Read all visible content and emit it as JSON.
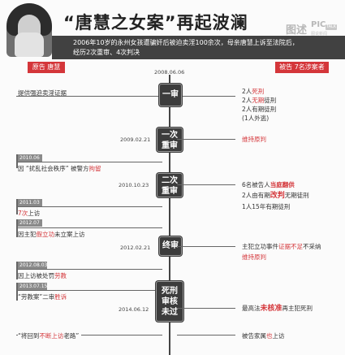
{
  "header": {
    "title": "“唐慧之女案”再起波澜",
    "logo_cn": "图述",
    "logo_pic": "PIC",
    "logo_tag": "TALK",
    "logo_sub": "图说新闻",
    "summary_line1": "2006年10岁的永州女孩遭骗奸后被迫卖淫100余次，母亲唐慧上诉至法院后，",
    "summary_line2": "经历2次重审、4次判决"
  },
  "badges": {
    "left": "原告 唐慧",
    "right": "被告 7名涉案者"
  },
  "top_date": "2008.06.06",
  "stages": [
    {
      "label": "一审",
      "date": ""
    },
    {
      "label_l1": "一次",
      "label_l2": "重审",
      "date": "2009.02.21"
    },
    {
      "label_l1": "二次",
      "label_l2": "重审",
      "date": "2010.10.23"
    },
    {
      "label": "终审",
      "date": "2012.02.21"
    },
    {
      "label_l1": "死刑",
      "label_l2": "审核",
      "label_l3": "未过",
      "date": "2014.06.12"
    }
  ],
  "left_events": [
    {
      "text": "提供强迫卖淫证据"
    },
    {
      "tag": "2010.06",
      "pre": "因 “扰乱社会秩序” 被警方",
      "hl": "拘留"
    },
    {
      "tag": "2011.03",
      "hl": "7次",
      "post": "上访"
    },
    {
      "tag": "2012.07",
      "pre": "因主犯",
      "hl": "假立功",
      "post": "未立案上访"
    },
    {
      "tag": "2012.08.03",
      "pre": "因上访被处罚",
      "hl": "劳教"
    },
    {
      "tag": "2013.07.15",
      "pre": "“劳教案”二审",
      "hl": "胜诉"
    },
    {
      "pre": "“将回到",
      "hl": "不断上访",
      "post": "老路”"
    }
  ],
  "right_events": {
    "first": {
      "l1_pre": "2人",
      "l1_hl": "死刑",
      "l2_pre": "2人",
      "l2_hl": "无期",
      "l2_post": "徒刑",
      "l3": "2人有期徒刑",
      "l4": "(1人外逃)"
    },
    "retrial1": {
      "hl": "维持原判"
    },
    "retrial2": {
      "l1_pre": "6名被告人",
      "l1_hl": "当庭翻供",
      "l2_pre": "2人由有期",
      "l2_hl": "改判",
      "l2_post": "无期徒刑",
      "l3": "1人15年有期徒刑"
    },
    "final": {
      "l1_pre": "主犯立功事件",
      "l1_hl": "证据不足",
      "l1_post": "不采纳",
      "l2_hl": "维持原判"
    },
    "review": {
      "pre": "最高法",
      "hl": "未核准",
      "post": "再主犯死刑"
    },
    "last": {
      "pre": "被告家属",
      "hl": "也",
      "post": "上访"
    }
  }
}
